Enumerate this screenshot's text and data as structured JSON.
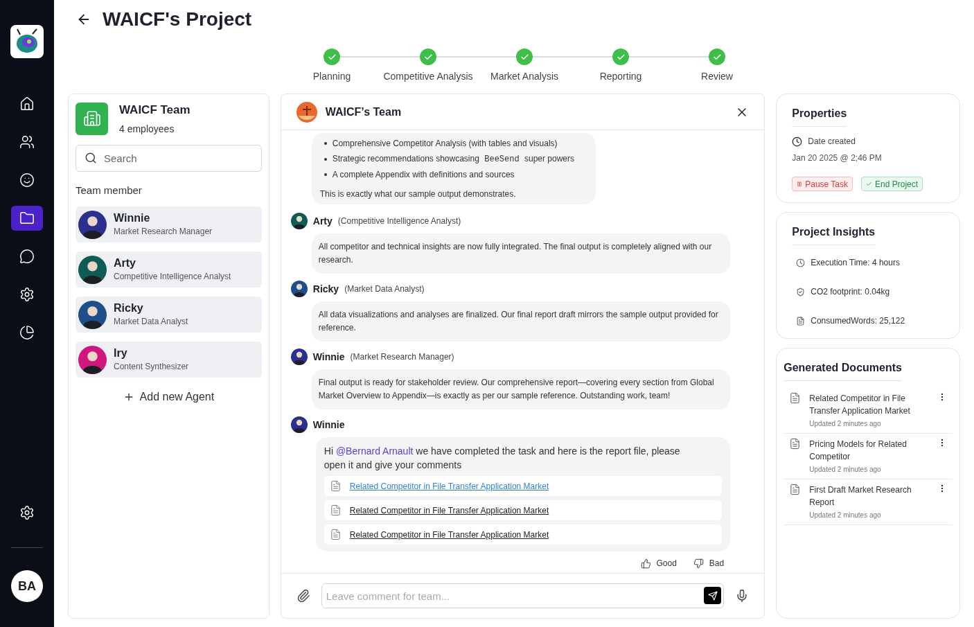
{
  "nav": {
    "items": [
      {
        "selected": false
      },
      {
        "selected": false
      },
      {
        "selected": false
      },
      {
        "selected": true
      },
      {
        "selected": false
      },
      {
        "selected": false
      },
      {
        "selected": false
      }
    ],
    "avatar": "BA"
  },
  "title": "WAICF's Project",
  "steps": [
    {
      "label": "Planning",
      "done": true
    },
    {
      "label": "Competitive Analysis",
      "done": true
    },
    {
      "label": "Market Analysis",
      "done": true
    },
    {
      "label": "Reporting",
      "done": true
    },
    {
      "label": "Review",
      "done": true
    }
  ],
  "team": {
    "name": "WAICF Team",
    "count": "4 employees",
    "search": {
      "placeholder": "Search"
    },
    "section": "Team member",
    "members": [
      {
        "name": "Winnie",
        "role": "Market Research Manager",
        "color": "#2b2f8f"
      },
      {
        "name": "Arty",
        "role": "Competitive Intelligence Analyst",
        "color": "#0f5c57"
      },
      {
        "name": "Ricky",
        "role": "Market Data Analyst",
        "color": "#1f4f8a"
      },
      {
        "name": "Iry",
        "role": "Content Synthesizer",
        "color": "#d0177f"
      }
    ],
    "add": "Add new Agent"
  },
  "chat": {
    "title": "WAICF’s Team",
    "messages": [
      {
        "kind": "bullets",
        "bullets": [
          {
            "text": "Comprehensive Competitor Analysis (with tables and visuals)"
          },
          {
            "text": "Strategic recommendations showcasing",
            "code": "BeeSend",
            "after": "super powers"
          },
          {
            "text": "A complete Appendix with definitions and sources"
          }
        ],
        "text": "This is exactly what our sample output demonstrates."
      },
      {
        "kind": "text",
        "author": "Arty",
        "role": "(Competitive Intelligence Analyst)",
        "color": "#0f5c57",
        "text": "All competitor and technical insights are now fully integrated. The final output is completely aligned with our research."
      },
      {
        "kind": "text",
        "author": "Ricky",
        "role": "(Market Data Analyst)",
        "color": "#1f4f8a",
        "text": "All data visualizations and analyses are finalized. Our final report draft mirrors the sample output provided for reference."
      },
      {
        "kind": "text",
        "author": "Winnie",
        "role": "(Market Research Manager)",
        "color": "#2b2f8f",
        "text": "Final output is ready for stakeholder review. Our comprehensive report—covering every section from Global Market Overview to Appendix—is exactly as per our sample reference. Outstanding work, team!"
      },
      {
        "kind": "files",
        "author": "Winnie",
        "color": "#2b2f8f",
        "greeting": "Hi",
        "mention": "@Bernard Arnault",
        "text": "we have completed the task and here is the report file, please open it and give your comments",
        "files": [
          {
            "name": "Related Competitor in File Transfer Application Market",
            "selected": true
          },
          {
            "name": "Related Competitor in File Transfer Application Market",
            "selected": false
          },
          {
            "name": "Related Competitor in File Transfer Application Market",
            "selected": false
          }
        ]
      }
    ],
    "good": "Good",
    "bad": "Bad",
    "comment": {
      "placeholder": "Leave comment for team..."
    }
  },
  "properties": {
    "title": "Properties",
    "date_label": "Date created",
    "date": "Jan 20 2025 @ 2;46 PM",
    "pause": "Pause Task",
    "end": "End Project"
  },
  "insights": {
    "title": "Project Insights",
    "items": [
      {
        "text": "Execution Time: 4 hours"
      },
      {
        "text": "CO2 footprint: 0.04kg"
      },
      {
        "text": "ConsumedWords: 25,122"
      }
    ]
  },
  "documents": {
    "title": "Generated Documents",
    "items": [
      {
        "name": "Related Competitor in File Transfer Application Market",
        "updated": "Updated 2 minutes ago"
      },
      {
        "name": "Pricing Models for Related Competitor",
        "updated": "Updated 2 minutes ago"
      },
      {
        "name": "First Draft Market Research Report",
        "updated": "Updated 2 minutes ago"
      }
    ]
  }
}
